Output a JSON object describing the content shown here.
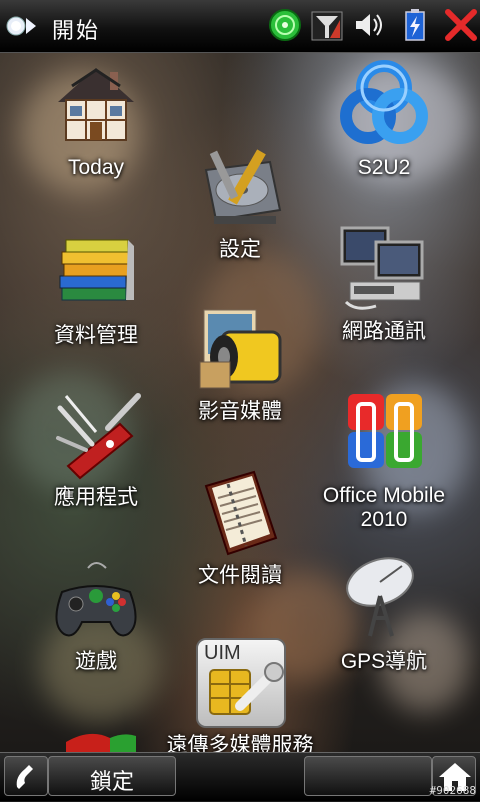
{
  "statusbar": {
    "title": "開始",
    "icons": [
      "start-icon",
      "connectivity-icon",
      "signal-icon",
      "volume-icon",
      "battery-icon",
      "close-icon"
    ]
  },
  "apps": [
    {
      "label": "Today",
      "icon": "house-icon"
    },
    {
      "label": "S2U2",
      "icon": "s2u2-knot-icon"
    },
    {
      "label": "設定",
      "icon": "settings-harddisk-icon"
    },
    {
      "label": "資料管理",
      "icon": "books-icon"
    },
    {
      "label": "網路通訊",
      "icon": "network-computers-icon"
    },
    {
      "label": "影音媒體",
      "icon": "film-photo-icon"
    },
    {
      "label": "應用程式",
      "icon": "swiss-knife-icon"
    },
    {
      "label": "Office Mobile 2010",
      "icon": "office-logo-icon"
    },
    {
      "label": "文件閱讀",
      "icon": "notebook-icon"
    },
    {
      "label": "遊戲",
      "icon": "gamepad-icon"
    },
    {
      "label": "GPS導航",
      "icon": "satellite-dish-icon"
    },
    {
      "label": "遠傳多媒體服務",
      "icon": "uim-sim-card-icon",
      "card_text": "UIM"
    }
  ],
  "bottombar": {
    "left_icon": "phone-icon",
    "lock_label": "鎖定",
    "right_icon": "home-icon"
  },
  "watermark": "#902688",
  "colors": {
    "close": "#e52a2a",
    "connectivity": "#2bbf3a",
    "battery": "#1e63d6"
  }
}
